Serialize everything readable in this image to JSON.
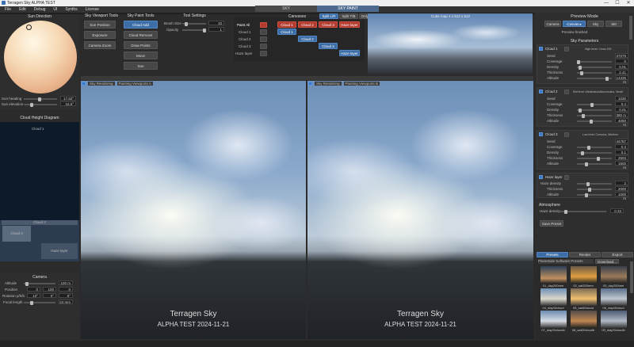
{
  "window": {
    "title": "Terragen Sky ALPHA TEST",
    "controls": [
      "—",
      "☐",
      "✕"
    ]
  },
  "menu": [
    "File",
    "Edit",
    "Debug",
    "UI",
    "Synths",
    "License"
  ],
  "top_tabs": [
    {
      "label": "SKY",
      "active": false
    },
    {
      "label": "SKY PAINT",
      "active": true
    }
  ],
  "sun": {
    "title": "Sun Direction",
    "heading_label": "Sun heading",
    "heading_value": "17.62°",
    "elevation_label": "Sun elevation",
    "elevation_value": "16.6°"
  },
  "cloud_height": {
    "title": "Cloud Height Diagram",
    "top_label": "Cloud 1",
    "box_labels": [
      "Cloud 2",
      "Cloud 3",
      "Haze layer"
    ]
  },
  "camera": {
    "title": "Camera",
    "altitude_label": "Altitude",
    "altitude": "100 m",
    "position_label": "Position",
    "position": [
      "0",
      "100",
      "0"
    ],
    "rotation_label": "Rotation p/h/b",
    "rotation": [
      "10°",
      "0°",
      "0°"
    ],
    "focal_label": "Focal length",
    "focal": "24 mm"
  },
  "viewport_tools": {
    "title": "Sky Viewport Tools",
    "buttons": [
      "Sun Position",
      "Exposure",
      "Camera Zoom"
    ]
  },
  "paint_tools": {
    "title": "Sky Paint Tools",
    "buttons": [
      "Cloud Add",
      "Cloud Remove",
      "Draw Points",
      "Move",
      "Sun"
    ],
    "active": "Cloud Add"
  },
  "tool_settings": {
    "title": "Tool Settings",
    "brush_label": "Brush Size",
    "brush_value": "10",
    "opacity_label": "Opacity",
    "opacity_value": "1"
  },
  "paint_grid": {
    "rows": [
      "Paint All",
      "Cloud 1",
      "Cloud 2",
      "Cloud 3",
      "Haze layer"
    ],
    "canvases_title": "Canvases",
    "canvas_tabs": [
      "Split L/R",
      "Split T/B",
      "Only Paint"
    ],
    "columns": [
      "Cloud 1",
      "Cloud 2",
      "Cloud 3",
      "Haze layer"
    ]
  },
  "preview_top": {
    "label": "Cube map 4 x 512 x 512"
  },
  "viewports": [
    {
      "header_check": "Sky Rendering",
      "header_label": "Painting Viewports A",
      "title": "Terragen Sky",
      "subtitle": "ALPHA TEST 2024-11-21"
    },
    {
      "header_check": "Sky Rendering",
      "header_label": "Painting Viewports B",
      "title": "Terragen Sky",
      "subtitle": "ALPHA TEST 2024-11-21"
    }
  ],
  "preview_mode": {
    "title": "Preview Mode",
    "buttons": [
      "Camera",
      "Canvas ▸",
      "Sky",
      "Skt"
    ],
    "status": "Preview finished"
  },
  "sky_params": {
    "title": "Sky Parameters",
    "layers": [
      {
        "name": "Cloud 1",
        "tag": "High level: Cirrus 200",
        "rows": [
          [
            "Seed",
            "37079"
          ],
          [
            "Coverage",
            "0"
          ],
          [
            "Density",
            "0.01"
          ],
          [
            "Thickness",
            "2.41 m"
          ],
          [
            "Altitude",
            "14335 m"
          ]
        ]
      },
      {
        "name": "Cloud 2",
        "tag": "Mid level: Altostratus/Altocumulus, Small",
        "rows": [
          [
            "Seed",
            "1030"
          ],
          [
            "Coverage",
            "0.4"
          ],
          [
            "Density",
            "0.01"
          ],
          [
            "Thickness",
            "380 m"
          ],
          [
            "Altitude",
            "4050 m"
          ]
        ]
      },
      {
        "name": "Cloud 3",
        "tag": "Low level: Cumulus, Medium",
        "rows": [
          [
            "Seed",
            "44757"
          ],
          [
            "Coverage",
            "0.3"
          ],
          [
            "Density",
            "0.1"
          ],
          [
            "Thickness",
            "2503 m"
          ],
          [
            "Altitude",
            "1500 m"
          ]
        ]
      },
      {
        "name": "Haze layer",
        "tag": "",
        "rows": [
          [
            "Haze density",
            "2"
          ],
          [
            "Thickness",
            "2000 m"
          ],
          [
            "Altitude",
            "1000 m"
          ]
        ]
      }
    ],
    "atmosphere_title": "Atmosphere",
    "atmo_label": "Haze density",
    "atmo_value": "0.33",
    "save_label": "Save Preset"
  },
  "presets": {
    "tabs": [
      "Presets",
      "Render",
      "Export"
    ],
    "source": "Planetside Software Presets",
    "download": "Download...",
    "items": [
      "01_day200mm",
      "02_sat200mm",
      "03_day200mm",
      "04_day40cloud",
      "05_sat40cloud",
      "06_day40cloud",
      "07_day20cloudb",
      "08_sat20cloudb",
      "09_day20cloudb",
      "10_day20cloud",
      "11_sat20cloud",
      "12_day20cloud"
    ]
  }
}
